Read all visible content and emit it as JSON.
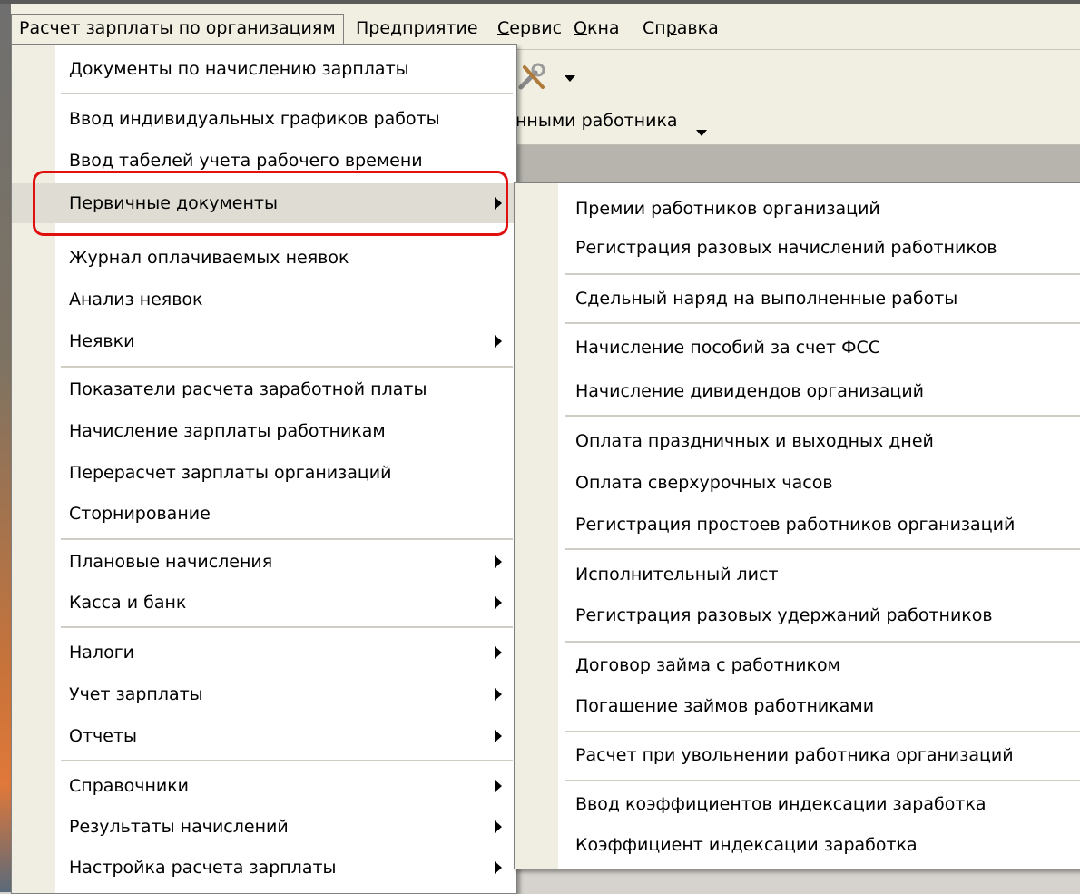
{
  "menubar": {
    "items": [
      {
        "label": "Расчет зарплаты по организациям"
      },
      {
        "label": "Предприятие"
      },
      {
        "pre": "",
        "acc": "С",
        "post": "ервис"
      },
      {
        "pre": "",
        "acc": "О",
        "post": "кна"
      },
      {
        "pre": "Сп",
        "acc": "р",
        "post": "авка"
      }
    ]
  },
  "toolbar": {
    "text": "нными работника",
    "tool_icon": "tools-icon"
  },
  "main_menu": {
    "items": [
      {
        "label": "Документы по начислению зарплаты"
      },
      {
        "label": "Ввод индивидуальных графиков работы"
      },
      {
        "label": "Ввод табелей учета рабочего времени"
      },
      {
        "label": "Первичные документы"
      },
      {
        "label": "Журнал оплачиваемых неявок"
      },
      {
        "label": "Анализ неявок"
      },
      {
        "label": "Неявки"
      },
      {
        "label": "Показатели расчета заработной платы"
      },
      {
        "label": "Начисление зарплаты работникам"
      },
      {
        "label": "Перерасчет зарплаты организаций"
      },
      {
        "label": "Сторнирование"
      },
      {
        "label": "Плановые начисления"
      },
      {
        "label": "Касса и банк"
      },
      {
        "label": "Налоги"
      },
      {
        "label": "Учет зарплаты"
      },
      {
        "label": "Отчеты"
      },
      {
        "label": "Справочники"
      },
      {
        "label": "Результаты начислений"
      },
      {
        "label": "Настройка расчета зарплаты"
      }
    ]
  },
  "sub_menu": {
    "items": [
      {
        "label": "Премии работников организаций"
      },
      {
        "label": "Регистрация разовых начислений работников"
      },
      {
        "label": "Сдельный наряд на выполненные работы"
      },
      {
        "label": "Начисление пособий за счет ФСС"
      },
      {
        "label": "Начисление дивидендов организаций"
      },
      {
        "label": "Оплата праздничных и выходных дней"
      },
      {
        "label": "Оплата сверхурочных часов"
      },
      {
        "label": "Регистрация простоев работников организаций"
      },
      {
        "label": "Исполнительный лист"
      },
      {
        "label": "Регистрация разовых удержаний работников"
      },
      {
        "label": "Договор займа с работником"
      },
      {
        "label": "Погашение займов работниками"
      },
      {
        "label": "Расчет при увольнении работника организаций"
      },
      {
        "label": "Ввод коэффициентов индексации заработка"
      },
      {
        "label": "Коэффициент индексации заработка"
      }
    ]
  },
  "colors": {
    "highlight_box": "#e0100f",
    "menu_bg": "#ffffff",
    "gutter": "#f0eee3"
  }
}
